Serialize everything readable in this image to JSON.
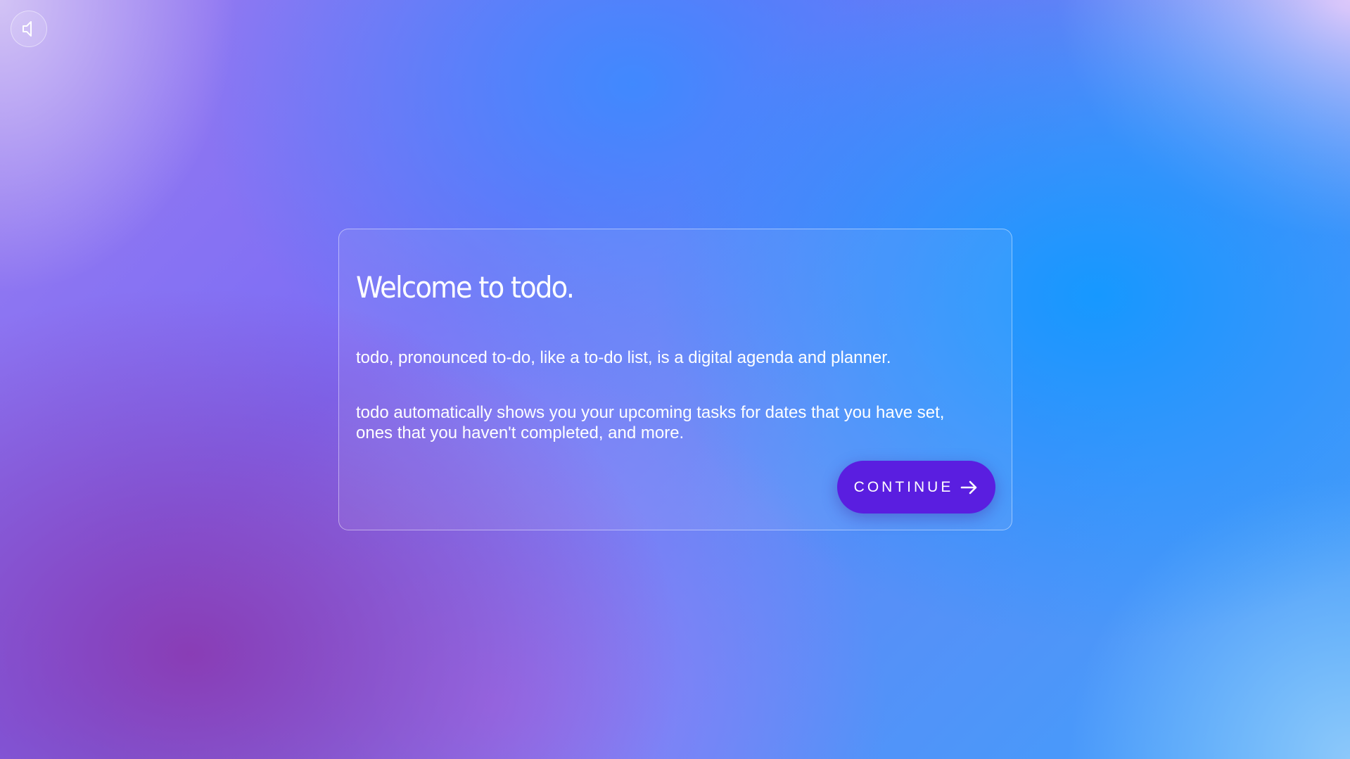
{
  "sound_toggle": {
    "icon": "speaker-icon"
  },
  "welcome_card": {
    "title": "Welcome to todo.",
    "paragraph_1": "todo, pronounced to-do, like a to-do list, is a digital agenda and planner.",
    "paragraph_2": "todo automatically shows you your upcoming tasks for dates that you have set, ones that you haven't completed, and more.",
    "continue_button": {
      "label": "CONTINUE",
      "icon": "arrow-right-icon"
    }
  },
  "colors": {
    "button_background": "#5a1ee0",
    "text": "#ffffff"
  }
}
